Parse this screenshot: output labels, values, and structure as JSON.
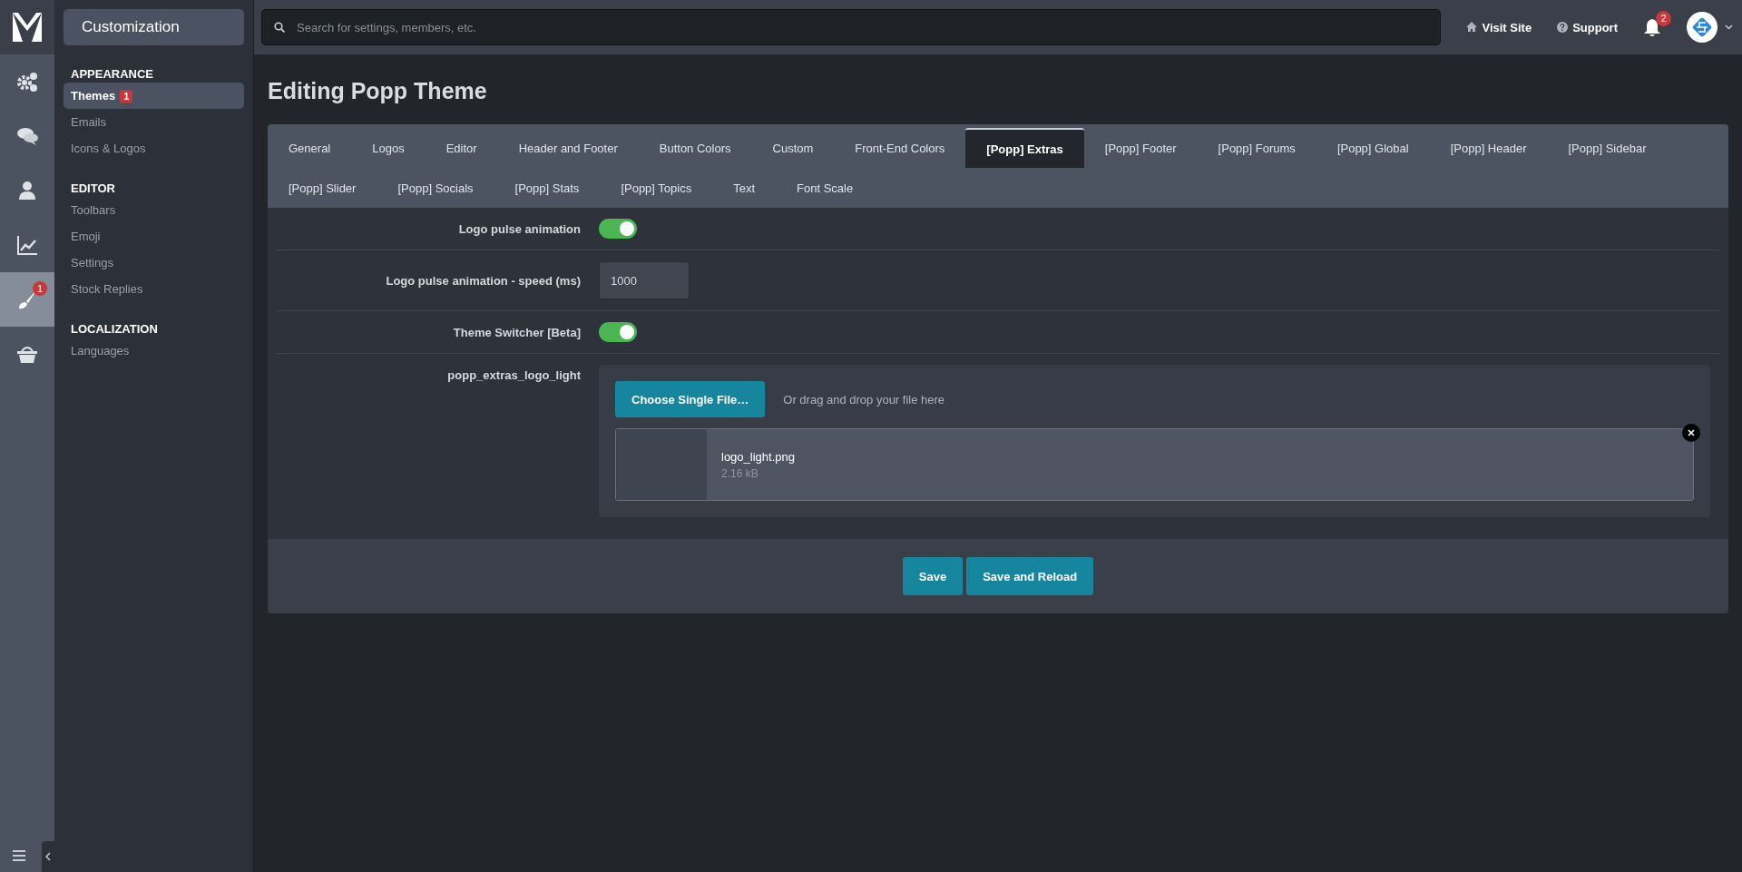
{
  "sidebar_title": "Customization",
  "rail": [
    {
      "kind": "gears",
      "selected": false
    },
    {
      "kind": "chat",
      "selected": false
    },
    {
      "kind": "user",
      "selected": false
    },
    {
      "kind": "chart",
      "selected": false
    },
    {
      "kind": "brush",
      "selected": true,
      "badge": "1"
    },
    {
      "kind": "basket",
      "selected": false
    }
  ],
  "nav": [
    {
      "heading": "APPEARANCE",
      "items": [
        {
          "label": "Themes",
          "selected": true,
          "badge": "1"
        },
        {
          "label": "Emails",
          "selected": false
        },
        {
          "label": "Icons & Logos",
          "selected": false
        }
      ]
    },
    {
      "heading": "EDITOR",
      "items": [
        {
          "label": "Toolbars",
          "selected": false
        },
        {
          "label": "Emoji",
          "selected": false
        },
        {
          "label": "Settings",
          "selected": false
        },
        {
          "label": "Stock Replies",
          "selected": false
        }
      ]
    },
    {
      "heading": "LOCALIZATION",
      "items": [
        {
          "label": "Languages",
          "selected": false
        }
      ]
    }
  ],
  "search": {
    "placeholder": "Search for settings, members, etc."
  },
  "top_links": [
    {
      "kind": "home",
      "label": "Visit Site"
    },
    {
      "kind": "help",
      "label": "Support"
    }
  ],
  "notifications": {
    "count": "2"
  },
  "page_title": "Editing Popp Theme",
  "tabs": [
    {
      "label": "General",
      "selected": false
    },
    {
      "label": "Logos",
      "selected": false
    },
    {
      "label": "Editor",
      "selected": false
    },
    {
      "label": "Header and Footer",
      "selected": false
    },
    {
      "label": "Button Colors",
      "selected": false
    },
    {
      "label": "Custom",
      "selected": false
    },
    {
      "label": "Front-End Colors",
      "selected": false
    },
    {
      "label": "[Popp] Extras",
      "selected": true
    },
    {
      "label": "[Popp] Footer",
      "selected": false
    },
    {
      "label": "[Popp] Forums",
      "selected": false
    },
    {
      "label": "[Popp] Global",
      "selected": false
    },
    {
      "label": "[Popp] Header",
      "selected": false
    },
    {
      "label": "[Popp] Sidebar",
      "selected": false
    },
    {
      "label": "[Popp] Slider",
      "selected": false
    },
    {
      "label": "[Popp] Socials",
      "selected": false
    },
    {
      "label": "[Popp] Stats",
      "selected": false
    },
    {
      "label": "[Popp] Topics",
      "selected": false
    },
    {
      "label": "Text",
      "selected": false
    },
    {
      "label": "Font Scale",
      "selected": false
    }
  ],
  "settings": [
    {
      "kind": "toggle",
      "label": "Logo pulse animation",
      "on": true
    },
    {
      "kind": "number",
      "label": "Logo pulse animation - speed (ms)",
      "value": "1000"
    },
    {
      "kind": "toggle",
      "label": "Theme Switcher [Beta]",
      "on": true
    },
    {
      "kind": "upload",
      "label": "popp_extras_logo_light",
      "button": "Choose Single File…",
      "hint": "Or drag and drop your file here",
      "file": {
        "name": "logo_light.png",
        "size": "2.16 kB"
      }
    }
  ],
  "buttons": [
    "Save",
    "Save and Reload"
  ]
}
